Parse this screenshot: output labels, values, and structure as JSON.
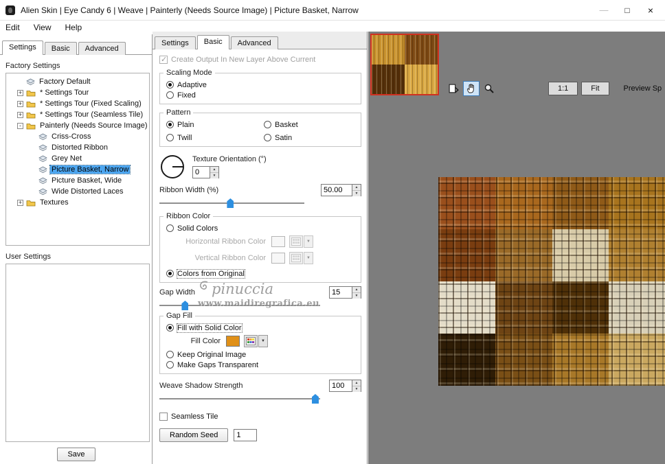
{
  "colors": {
    "selection_blue": "#4da6f0",
    "slider_blue": "#2d8fe0",
    "preview_background": "#7d7d7d",
    "thumbnail_border_red": "#d03020",
    "fill_color_swatch": "#e09018"
  },
  "window": {
    "title": "Alien Skin | Eye Candy 6 | Weave | Painterly (Needs Source Image) | Picture Basket, Narrow",
    "minimize": "—",
    "maximize": "□",
    "close": "×"
  },
  "menu": {
    "edit": "Edit",
    "view": "View",
    "help": "Help"
  },
  "presets": {
    "tabs": {
      "settings": "Settings",
      "basic": "Basic",
      "advanced": "Advanced"
    },
    "factory_label": "Factory Settings",
    "user_label": "User Settings",
    "save_button": "Save",
    "tree": [
      {
        "label": "Factory Default"
      },
      {
        "label": "* Settings Tour",
        "toggle": "+"
      },
      {
        "label": "* Settings Tour (Fixed Scaling)",
        "toggle": "+"
      },
      {
        "label": "* Settings Tour (Seamless Tile)",
        "toggle": "+"
      },
      {
        "label": "Painterly (Needs Source Image)",
        "toggle": "-"
      },
      {
        "label": "Criss-Cross"
      },
      {
        "label": "Distorted Ribbon"
      },
      {
        "label": "Grey Net"
      },
      {
        "label": "Picture Basket, Narrow"
      },
      {
        "label": "Picture Basket, Wide"
      },
      {
        "label": "Wide Distorted Laces"
      },
      {
        "label": "Textures",
        "toggle": "+"
      }
    ]
  },
  "controls": {
    "tabs": {
      "settings": "Settings",
      "basic": "Basic",
      "advanced": "Advanced"
    },
    "new_layer_label": "Create Output In New Layer Above Current",
    "scaling_mode": {
      "legend": "Scaling Mode",
      "adaptive": "Adaptive",
      "fixed": "Fixed"
    },
    "pattern": {
      "legend": "Pattern",
      "plain": "Plain",
      "basket": "Basket",
      "twill": "Twill",
      "satin": "Satin"
    },
    "texture_orientation": {
      "label": "Texture Orientation (°)",
      "value": "0"
    },
    "ribbon_width": {
      "label": "Ribbon Width (%)",
      "value": "50.00",
      "thumb_percent": 49
    },
    "ribbon_color": {
      "legend": "Ribbon Color",
      "solid_colors": "Solid Colors",
      "horizontal": "Horizontal Ribbon Color",
      "vertical": "Vertical Ribbon Color",
      "from_original": "Colors from Original"
    },
    "gap_width": {
      "label": "Gap Width",
      "value": "15",
      "thumb_percent": 16
    },
    "gap_fill": {
      "legend": "Gap Fill",
      "fill_solid": "Fill with Solid Color",
      "fill_color_label": "Fill Color",
      "keep_original": "Keep Original Image",
      "make_transparent": "Make Gaps Transparent"
    },
    "weave_shadow": {
      "label": "Weave Shadow Strength",
      "value": "100",
      "thumb_percent": 97
    },
    "seamless_tile_label": "Seamless Tile",
    "random_seed": {
      "button": "Random Seed",
      "value": "1"
    }
  },
  "preview": {
    "zoom_1to1": "1:1",
    "zoom_fit": "Fit",
    "preview_split": "Preview Sp",
    "tool_icons": [
      "original-preview-icon",
      "hand-tool-icon",
      "zoom-tool-icon"
    ],
    "thumb_rows": [
      [
        "#c8922e",
        "#7e4a14"
      ],
      [
        "#55300a",
        "#d9a843"
      ]
    ],
    "image_rows": [
      [
        "#9a4f1c",
        "#a9681e",
        "#8f5a18",
        "#a8741e"
      ],
      [
        "#7a3d10",
        "#9a6a28",
        "#d8cba8",
        "#b08030"
      ],
      [
        "#e3dcc8",
        "#6e4414",
        "#4f3008",
        "#d8d0b8"
      ],
      [
        "#2f1d06",
        "#7a4f16",
        "#a87828",
        "#caa860"
      ]
    ]
  },
  "watermark": {
    "line1": "pinuccia",
    "line2": "www.maidiregrafica.eu"
  }
}
